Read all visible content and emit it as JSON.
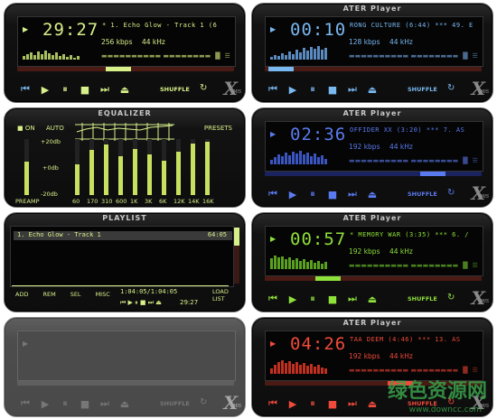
{
  "player_1": {
    "title": "",
    "time": "29:27",
    "marquee": "* 1. Echo Glow - Track 1 (6",
    "bitrate": "256 kbps",
    "samplerate": "44 kHz",
    "shuffle": "SHUFFLE",
    "logo": "X",
    "logo_sub": "MIS",
    "accent": "#d7f08a"
  },
  "player_2": {
    "title": "ATER Player",
    "time": "00:10",
    "marquee": "RONG CULTURE (6:44) *** 49. E",
    "bitrate": "128 kbps",
    "samplerate": "44 kHz",
    "shuffle": "SHUFFLE",
    "logo": "X",
    "logo_sub": "MIS",
    "accent": "#79b8f0"
  },
  "equalizer": {
    "title": "EQUALIZER",
    "on": "ON",
    "auto": "AUTO",
    "presets": "PRESETS",
    "preamp": "PREAMP",
    "db_top": "+20db",
    "db_mid": "+0db",
    "db_bot": "-20db",
    "bands": [
      "60",
      "170",
      "310",
      "600",
      "1K",
      "3K",
      "6K",
      "12K",
      "14K",
      "16K"
    ],
    "levels": [
      0.55,
      0.8,
      0.9,
      0.7,
      0.82,
      0.72,
      0.62,
      0.78,
      0.92,
      0.95
    ],
    "preamp_level": 0.6,
    "accent": "#d7f08a"
  },
  "player_3": {
    "title": "ATER Player",
    "time": "02:36",
    "marquee": "OFFIDER XX (3:20) *** 7. AS",
    "bitrate": "192 kbps",
    "samplerate": "44 kHz",
    "shuffle": "SHUFFLE",
    "logo": "X",
    "logo_sub": "MIS",
    "accent": "#5a7bf0"
  },
  "playlist": {
    "title": "PLAYLIST",
    "items": [
      {
        "name": "1. Echo Glow - Track 1",
        "duration": "64:05"
      }
    ],
    "buttons": [
      "ADD",
      "REM",
      "SEL",
      "MISC"
    ],
    "total": "1:04:05/1:04:05",
    "time": "29:27",
    "load_list_1": "LOAD",
    "load_list_2": "LIST",
    "accent": "#d7f08a"
  },
  "player_4": {
    "title": "ATER Player",
    "time": "00:57",
    "marquee": "* MEMORY WAR (3:35) *** 6. /",
    "bitrate": "192 kbps",
    "samplerate": "44 kHz",
    "shuffle": "SHUFFLE",
    "logo": "X",
    "logo_sub": "MIS",
    "accent": "#8ee03a"
  },
  "player_5": {
    "title": "",
    "shuffle": "SHUFFLE",
    "logo": "X",
    "logo_sub": "MIS",
    "accent": "#5a5a5a"
  },
  "player_6": {
    "title": "ATER Player",
    "time": "04:26",
    "marquee": "TAA DEEM (4:46) *** 13. AS",
    "bitrate": "192 kbps",
    "samplerate": "44 kHz",
    "shuffle": "SHUFFLE",
    "logo": "X",
    "logo_sub": "MIS",
    "accent": "#f04a3a"
  },
  "watermark": {
    "main": "绿色资源网",
    "sub": "www.downcc.com"
  }
}
